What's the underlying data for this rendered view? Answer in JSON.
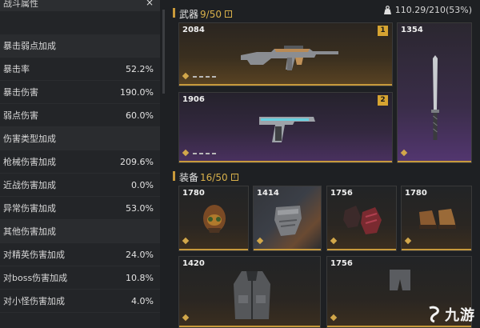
{
  "stats": {
    "header_partial": "战斗属性",
    "close_glyph": "×",
    "rows": [
      {
        "type": "section",
        "label": "暴击弱点加成"
      },
      {
        "type": "stat",
        "label": "暴击率",
        "value": "52.2%"
      },
      {
        "type": "stat",
        "label": "暴击伤害",
        "value": "190.0%"
      },
      {
        "type": "stat",
        "label": "弱点伤害",
        "value": "60.0%"
      },
      {
        "type": "section",
        "label": "伤害类型加成"
      },
      {
        "type": "stat",
        "label": "枪械伤害加成",
        "value": "209.6%"
      },
      {
        "type": "stat",
        "label": "近战伤害加成",
        "value": "0.0%"
      },
      {
        "type": "stat",
        "label": "异常伤害加成",
        "value": "53.0%"
      },
      {
        "type": "section",
        "label": "其他伤害加成"
      },
      {
        "type": "stat",
        "label": "对精英伤害加成",
        "value": "24.0%"
      },
      {
        "type": "stat",
        "label": "对boss伤害加成",
        "value": "10.8%"
      },
      {
        "type": "stat",
        "label": "对小怪伤害加成",
        "value": "4.0%"
      }
    ]
  },
  "weight": {
    "icon": "weight-icon",
    "text": "110.29/210(53%)"
  },
  "weapons": {
    "title": "武器",
    "count": "9/50",
    "info_glyph": "i",
    "items": [
      {
        "power": "2084",
        "slot": "1",
        "rarity": "legendary",
        "icon": "assault-rifle-icon"
      },
      {
        "power": "1354",
        "slot": "",
        "rarity": "epic",
        "icon": "blade-icon"
      },
      {
        "power": "1906",
        "slot": "2",
        "rarity": "epic",
        "icon": "pistol-icon"
      }
    ]
  },
  "gear": {
    "title": "装备",
    "count": "16/50",
    "info_glyph": "i",
    "items": [
      {
        "power": "1780",
        "rarity": "legendary",
        "icon": "helmet-icon"
      },
      {
        "power": "1414",
        "rarity": "legendary",
        "icon": "mask-icon"
      },
      {
        "power": "1756",
        "rarity": "legendary",
        "icon": "gloves-icon"
      },
      {
        "power": "1780",
        "rarity": "legendary",
        "icon": "boots-icon"
      },
      {
        "power": "1420",
        "rarity": "legendary",
        "icon": "jacket-icon"
      },
      {
        "power": "1756",
        "rarity": "legendary",
        "icon": "pants-icon"
      }
    ]
  },
  "watermark": {
    "text": "九游"
  },
  "colors": {
    "gold": "#c79a3c",
    "slot_badge": "#d6a431",
    "count": "#d9b14b"
  }
}
